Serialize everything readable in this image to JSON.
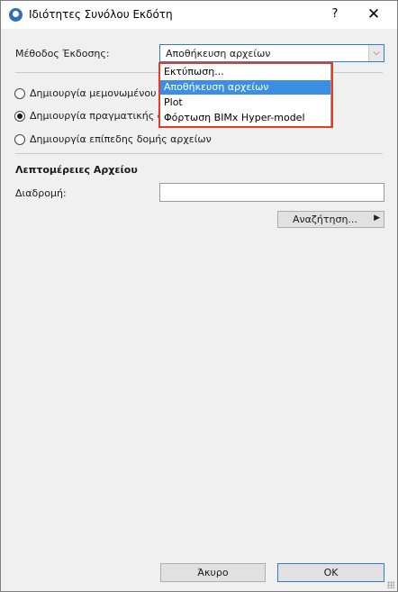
{
  "window": {
    "title": "Ιδιότητες Συνόλου Εκδότη",
    "help_label": "?",
    "close_label": "✕"
  },
  "method": {
    "label": "Μέθοδος Έκδοσης:",
    "selected_value": "Αποθήκευση αρχείων",
    "arrow": "⌵"
  },
  "dropdown": {
    "items": [
      {
        "label": "Εκτύπωση..."
      },
      {
        "label": "Αποθήκευση αρχείων",
        "selected": true
      },
      {
        "label": "Plot"
      },
      {
        "label": "Φόρτωση BIMx Hyper-model"
      }
    ]
  },
  "options": [
    {
      "label": "Δημιουργία μεμονωμένου α",
      "checked": false
    },
    {
      "label": "Δημιουργία πραγματικής δ",
      "checked": true
    },
    {
      "label": "Δημιουργία επίπεδης δομής αρχείων",
      "checked": false
    }
  ],
  "file_details": {
    "heading": "Λεπτομέρειες Αρχείου",
    "path_label": "Διαδρομή:",
    "path_value": "",
    "search_label": "Αναζήτηση...",
    "search_arrow": "▶"
  },
  "footer": {
    "cancel_label": "Άκυρο",
    "ok_label": "OK"
  },
  "colors": {
    "accent": "#2f7fd0",
    "selection": "#3b8ee0",
    "annotation": "#e43d24"
  }
}
